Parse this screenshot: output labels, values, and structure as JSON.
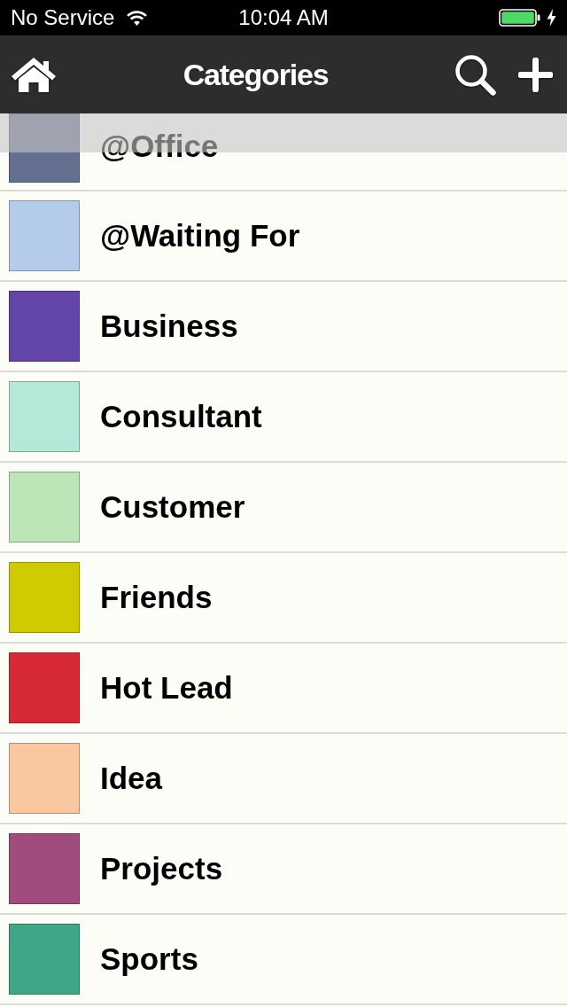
{
  "status_bar": {
    "carrier": "No Service",
    "time": "10:04 AM"
  },
  "nav_bar": {
    "title": "Categories"
  },
  "categories": [
    {
      "name": "@Office",
      "color": "#64708f"
    },
    {
      "name": "@Waiting For",
      "color": "#b4cbe9"
    },
    {
      "name": "Business",
      "color": "#6446aa"
    },
    {
      "name": "Consultant",
      "color": "#b4e8d8"
    },
    {
      "name": "Customer",
      "color": "#bde6b8"
    },
    {
      "name": "Friends",
      "color": "#d0cb00"
    },
    {
      "name": "Hot Lead",
      "color": "#d82a36"
    },
    {
      "name": "Idea",
      "color": "#fac8a0"
    },
    {
      "name": "Projects",
      "color": "#a24c7e"
    },
    {
      "name": "Sports",
      "color": "#3fa687"
    }
  ]
}
